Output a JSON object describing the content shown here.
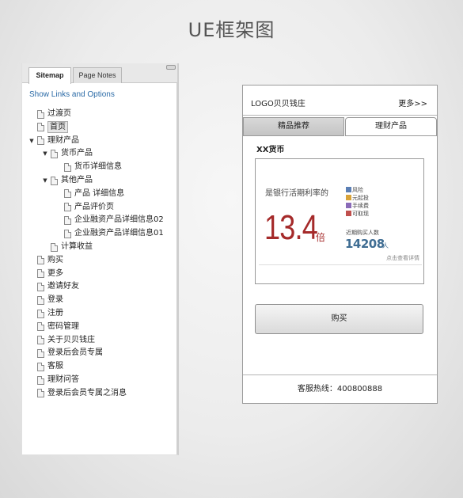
{
  "page_title": "UE框架图",
  "sitemap": {
    "tabs": [
      "Sitemap",
      "Page Notes"
    ],
    "show_links": "Show Links and Options",
    "tree": [
      {
        "label": "过渡页",
        "indent": 0,
        "caret": false
      },
      {
        "label": "首页",
        "indent": 0,
        "caret": false,
        "selected": true
      },
      {
        "label": "理财产品",
        "indent": 0,
        "caret": true
      },
      {
        "label": "货币产品",
        "indent": 1,
        "caret": true
      },
      {
        "label": "货币详细信息",
        "indent": 2,
        "caret": false
      },
      {
        "label": "其他产品",
        "indent": 1,
        "caret": true
      },
      {
        "label": "产品 详细信息",
        "indent": 2,
        "caret": false
      },
      {
        "label": "产品评价页",
        "indent": 2,
        "caret": false
      },
      {
        "label": "企业融资产品详细信息02",
        "indent": 2,
        "caret": false
      },
      {
        "label": "企业融资产品详细信息01",
        "indent": 2,
        "caret": false
      },
      {
        "label": "计算收益",
        "indent": 1,
        "caret": false
      },
      {
        "label": "购买",
        "indent": 0,
        "caret": false
      },
      {
        "label": "更多",
        "indent": 0,
        "caret": false
      },
      {
        "label": "邀请好友",
        "indent": 0,
        "caret": false
      },
      {
        "label": "登录",
        "indent": 0,
        "caret": false
      },
      {
        "label": "注册",
        "indent": 0,
        "caret": false
      },
      {
        "label": "密码管理",
        "indent": 0,
        "caret": false
      },
      {
        "label": "关于贝贝钱庄",
        "indent": 0,
        "caret": false
      },
      {
        "label": "登录后会员专属",
        "indent": 0,
        "caret": false
      },
      {
        "label": "客服",
        "indent": 0,
        "caret": false
      },
      {
        "label": "理财问答",
        "indent": 0,
        "caret": false
      },
      {
        "label": "登录后会员专属之消息",
        "indent": 0,
        "caret": false
      }
    ]
  },
  "phone": {
    "logo": "LOGO贝贝钱庄",
    "more": "更多>>",
    "tabs": [
      "精品推荐",
      "理财产品"
    ],
    "section_title": "XX货币",
    "card": {
      "rate_label": "是银行活期利率的",
      "rate_value": "13.4",
      "rate_unit": "倍",
      "features": [
        {
          "text": "风险",
          "color": "#5b7fb5"
        },
        {
          "text": "元起投",
          "color": "#d8a33a"
        },
        {
          "text": "手续费",
          "color": "#8a6bb8"
        },
        {
          "text": "可取现",
          "color": "#c0504d"
        }
      ],
      "buyers_label": "近期购买人数",
      "buyers_value": "14208",
      "buyers_unit": "人",
      "detail_link": "点击查看详情"
    },
    "buy_button": "购买",
    "footer": "客服热线：400800888"
  }
}
